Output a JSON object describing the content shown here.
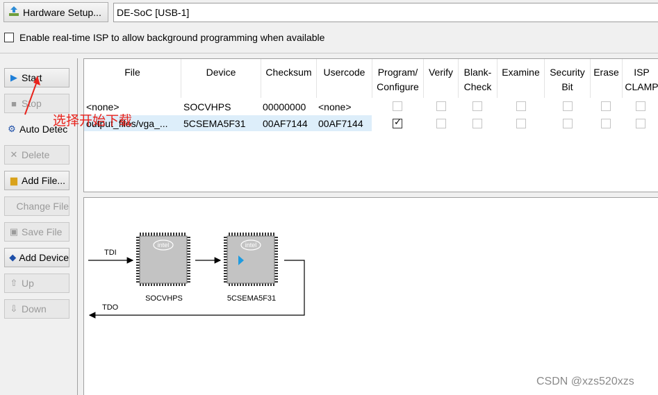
{
  "topbar": {
    "hardware_setup_label": "Hardware Setup...",
    "hardware_value": "DE-SoC [USB-1]",
    "isp_label": "Enable real-time ISP to allow background programming when available"
  },
  "toolbar": {
    "start": "Start",
    "stop": "Stop",
    "auto_detect": "Auto Detec",
    "delete": "Delete",
    "add_file": "Add File...",
    "change_file": "Change File",
    "save_file": "Save File",
    "add_device": "Add Device",
    "up": "Up",
    "down": "Down"
  },
  "table": {
    "headers": {
      "file": "File",
      "device": "Device",
      "checksum": "Checksum",
      "usercode": "Usercode",
      "program": "Program/\nConfigure",
      "verify": "Verify",
      "blank": "Blank-\nCheck",
      "examine": "Examine",
      "security": "Security\nBit",
      "erase": "Erase",
      "isp": "ISP\nCLAMP"
    },
    "rows": [
      {
        "file": "<none>",
        "device": "SOCVHPS",
        "checksum": "00000000",
        "usercode": "<none>",
        "program_checked": false
      },
      {
        "file": "output_files/vga_...",
        "device": "5CSEMA5F31",
        "checksum": "00AF7144",
        "usercode": "00AF7144",
        "program_checked": true
      }
    ]
  },
  "chain": {
    "tdi": "TDI",
    "tdo": "TDO",
    "chip_brand": "intel",
    "device1": "SOCVHPS",
    "device2": "5CSEMA5F31"
  },
  "annotation": "选择开始下载",
  "watermark": "CSDN @xzs520xzs",
  "colors": {
    "annotation": "#e8221b",
    "selected_row": "#ddeefa",
    "chip": "#c3c3c3",
    "chip_arrow": "#1e9be0"
  }
}
